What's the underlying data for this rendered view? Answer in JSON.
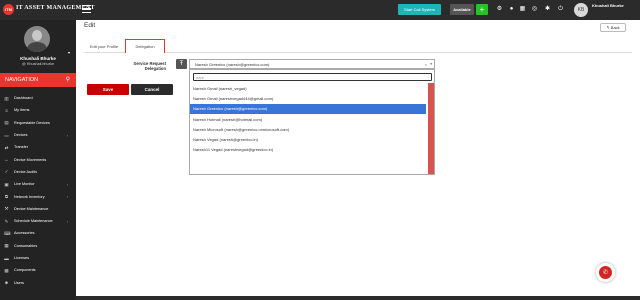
{
  "app": {
    "logo_text": "ITM",
    "brand": "IT ASSET MANAGEMENT"
  },
  "topbar": {
    "start_call": "Start Call System",
    "available": "Available",
    "add": "+",
    "user_initials": "KB",
    "user_name": "Khushali Bhurke",
    "icons": [
      "gear-icon",
      "bell-icon",
      "grid-icon",
      "globe-icon",
      "settings-icon",
      "power-icon"
    ]
  },
  "sidebar": {
    "user_name": "Khushali Bhurke",
    "user_handle": "@ Khushali.bhurke",
    "nav_title": "NAVIGATION",
    "items": [
      {
        "label": "Dashboard",
        "icon": "dashboard-icon",
        "glyph": "▥",
        "chevron": false
      },
      {
        "label": "My Items",
        "icon": "user-icon",
        "glyph": "☺",
        "chevron": false
      },
      {
        "label": "Requestable Devices",
        "icon": "request-icon",
        "glyph": "▤",
        "chevron": false
      },
      {
        "label": "Devices",
        "icon": "devices-icon",
        "glyph": "▭",
        "chevron": true
      },
      {
        "label": "Transfer",
        "icon": "transfer-icon",
        "glyph": "⇄",
        "chevron": false
      },
      {
        "label": "Device Movements",
        "icon": "movement-icon",
        "glyph": "↔",
        "chevron": false
      },
      {
        "label": "Device Audits",
        "icon": "audit-icon",
        "glyph": "✓",
        "chevron": false
      },
      {
        "label": "Live Monitor",
        "icon": "monitor-icon",
        "glyph": "▣",
        "chevron": true
      },
      {
        "label": "Network Inventory",
        "icon": "network-icon",
        "glyph": "⧉",
        "chevron": true
      },
      {
        "label": "Device Maintenance",
        "icon": "maintenance-icon",
        "glyph": "⚒",
        "chevron": false
      },
      {
        "label": "Schedule Maintenance",
        "icon": "wrench-icon",
        "glyph": "✎",
        "chevron": true
      },
      {
        "label": "Accessories",
        "icon": "accessories-icon",
        "glyph": "⌨",
        "chevron": false
      },
      {
        "label": "Consumables",
        "icon": "consumables-icon",
        "glyph": "▦",
        "chevron": false
      },
      {
        "label": "Licenses",
        "icon": "license-icon",
        "glyph": "▬",
        "chevron": false
      },
      {
        "label": "Components",
        "icon": "components-icon",
        "glyph": "▩",
        "chevron": false
      },
      {
        "label": "Users",
        "icon": "users-icon",
        "glyph": "☻",
        "chevron": false
      }
    ]
  },
  "main": {
    "title": "Edit",
    "back_label": "Back",
    "tabs": [
      {
        "label": "Edit your Profile"
      },
      {
        "label": "Delegation"
      }
    ],
    "delegation": {
      "label": "Service Request Delegation",
      "selected": "Naresh Greenlco (naresh@greenlco.com)",
      "search_placeholder": "nare",
      "options": [
        {
          "label": "Naresh Gmail (naresh_vegad)"
        },
        {
          "label": "Naresh Gmail (nareshvegad444@gmail.com)"
        },
        {
          "label": "Naresh Greenlco (naresh@greenlco.com)"
        },
        {
          "label": "Naresh Hotmail (naresh@hotmail.com)"
        },
        {
          "label": "Naresh Microsoft (naresh@greenlco.onmicrosoft.com)"
        },
        {
          "label": "Naresh Vegad (naresh@greenlco.in)"
        },
        {
          "label": "Naresh11 Vegad (nareshvegad@greenlco.in)"
        }
      ],
      "selected_index": 2
    },
    "save_label": "Save",
    "cancel_label": "Cancel"
  },
  "colors": {
    "accent": "#e8352e",
    "topbar": "#2b2b2b",
    "sidebar": "#232323",
    "highlight": "#3875d7",
    "call": "#1db5b5",
    "add": "#28c228"
  }
}
